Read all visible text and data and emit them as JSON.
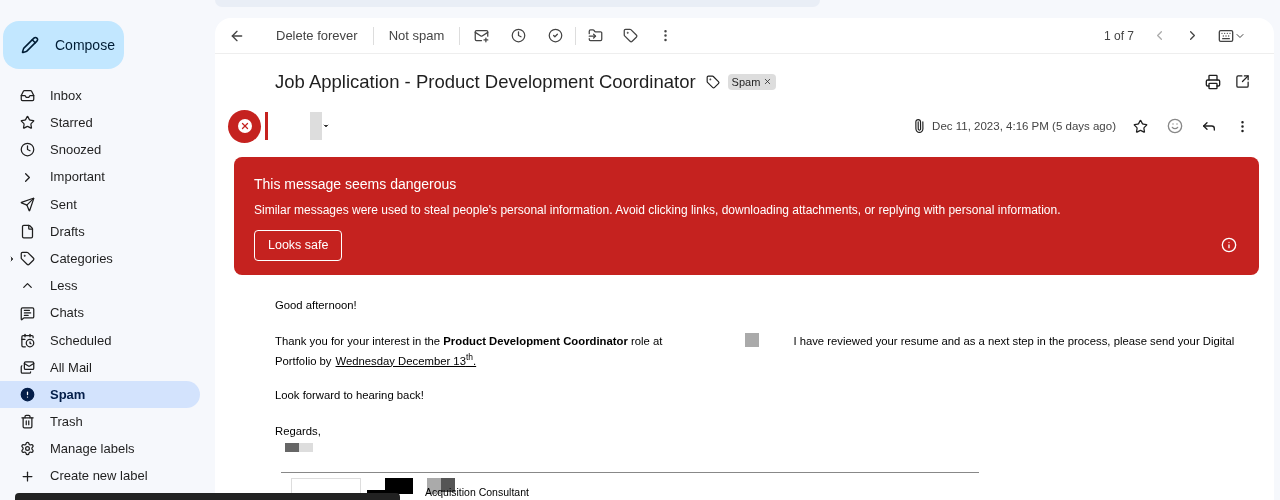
{
  "compose": {
    "label": "Compose"
  },
  "sidebar": {
    "items": [
      {
        "label": "Inbox",
        "selected": false
      },
      {
        "label": "Starred",
        "selected": false
      },
      {
        "label": "Snoozed",
        "selected": false
      },
      {
        "label": "Important",
        "selected": false
      },
      {
        "label": "Sent",
        "selected": false
      },
      {
        "label": "Drafts",
        "selected": false
      },
      {
        "label": "Categories",
        "selected": false
      },
      {
        "label": "Less",
        "selected": false
      },
      {
        "label": "Chats",
        "selected": false
      },
      {
        "label": "Scheduled",
        "selected": false
      },
      {
        "label": "All Mail",
        "selected": false
      },
      {
        "label": "Spam",
        "selected": true
      },
      {
        "label": "Trash",
        "selected": false
      },
      {
        "label": "Manage labels",
        "selected": false
      },
      {
        "label": "Create new label",
        "selected": false
      }
    ]
  },
  "toolbar": {
    "buttons": [
      "Delete forever",
      "Not spam"
    ],
    "pager": "1 of 7"
  },
  "message": {
    "subject": "Job Application - Product Development Coordinator",
    "label": "Spam",
    "date": "Dec 11, 2023, 4:16 PM (5 days ago)"
  },
  "warning": {
    "title": "This message seems dangerous",
    "text": "Similar messages were used to steal people's personal information. Avoid clicking links, downloading attachments, or replying with personal information.",
    "button": "Looks safe"
  },
  "body": {
    "greeting": "Good afternoon!",
    "line1_left": "Thank you for your interest in the **Product Development Coordinator** role at",
    "line1_right": "I have reviewed your resume and as a next step in the process, please send your Digital",
    "line2_prefix": "Portfolio by",
    "line2_date": "Wednesday December 13$^{th}$.",
    "closing": "Look forward to hearing back!",
    "signoff": "Regards,",
    "signature_title": "Acquisition Consultant"
  }
}
